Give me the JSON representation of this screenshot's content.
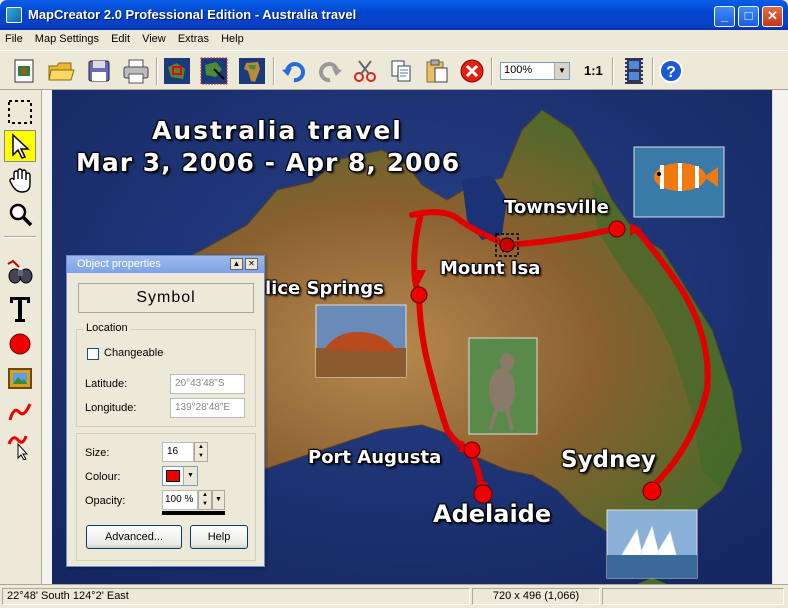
{
  "window": {
    "title": "MapCreator 2.0 Professional Edition - Australia travel"
  },
  "menu": [
    "File",
    "Map Settings",
    "Edit",
    "View",
    "Extras",
    "Help"
  ],
  "toolbar": {
    "zoom_value": "100%",
    "ratio_label": "1:1"
  },
  "map": {
    "title_line1": "Australia travel",
    "title_line2": "Mar 3, 2006 - Apr 8, 2006",
    "places": {
      "townsville": "Townsville",
      "mount_isa": "Mount Isa",
      "alice_springs": "lice Springs",
      "port_augusta": "Port Augusta",
      "sydney": "Sydney",
      "adelaide": "Adelaide"
    },
    "route_color": "#e00000",
    "ocean_color": "#1a2f78",
    "land_color": "#9a6a3a"
  },
  "props": {
    "title": "Object properties",
    "symbol_label": "Symbol",
    "location_group": "Location",
    "changeable_label": "Changeable",
    "latitude_label": "Latitude:",
    "latitude_value": "20°43'48\"S",
    "longitude_label": "Longitude:",
    "longitude_value": "139°28'48\"E",
    "size_label": "Size:",
    "size_value": "16",
    "colour_label": "Colour:",
    "colour_value": "#ee0000",
    "opacity_label": "Opacity:",
    "opacity_value": "100 %",
    "advanced_label": "Advanced...",
    "help_label": "Help"
  },
  "status": {
    "coords": "22°48' South   124°2' East",
    "size_info": "720 x 496  (1,066)"
  }
}
